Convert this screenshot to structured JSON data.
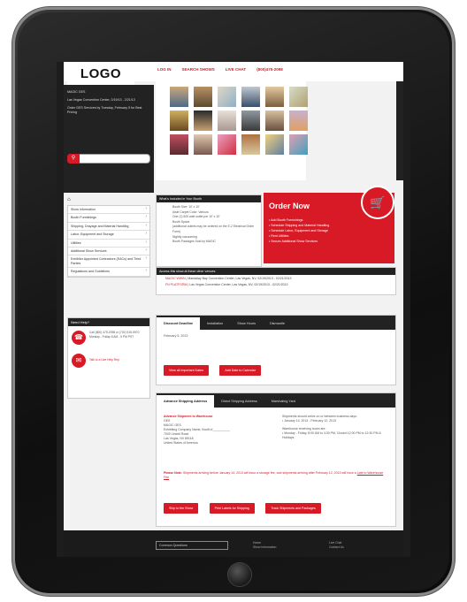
{
  "header": {
    "logo": "LOGO",
    "nav": [
      "LOG IN",
      "SEARCH SHOWS",
      "LIVE CHAT",
      "(800)475-2098"
    ]
  },
  "sidebar": {
    "show_name": "MAGIC GES",
    "location": "Las Vegas Convention Center, 2/19/13 - 2/21/13",
    "promo": "Order GES Services by Tuesday, February 5 for Best Pricing",
    "search_placeholder": "",
    "home_icon": "home-icon",
    "nav_items": [
      "Show Information",
      "Booth Furnishings",
      "Shipping, Drayage and Material Handling",
      "Labor, Equipment and Storage",
      "Utilities",
      "Additional Show Services",
      "Exhibitor Appointed Contractors (EACs) and Third Parties",
      "Regulations and Guidelines"
    ],
    "help": {
      "title": "Need Help?",
      "phone": "Call (800) 475-2098 or (702) 515-5970 Monday - Friday 8 AM - 5 PM PST",
      "chat": "Talk to a Live Help Rep"
    }
  },
  "included": {
    "title": "What's Included in Your Booth",
    "items": [
      "Booth Size: 10' x 10'",
      "Aisle Carpet Color: Various",
      "One (1) 500 watt outlet per 10' x 10'",
      "Booth Space",
      "(additional outlets may be ordered on the E-2 Electrical Order Form)",
      "Nightly vacuuming",
      "Booth Packages Sold by MAGIC"
    ]
  },
  "order_now": {
    "title": "Order Now",
    "cart_icon": "cart-icon",
    "items": [
      "Add Booth Furnishings",
      "Schedule Shipping and Material Handling",
      "Schedule Labor, Equipment and Storage",
      "Rent Utilities",
      "Secure Additional Show Services"
    ]
  },
  "other_venues": {
    "title": "Access this show at these other venues:",
    "rows": [
      {
        "link": "MAGIC WWIN",
        "text": "| Mandalay Bay Convention Center, Las Vegas, NV, 02/19/2013 - 02/21/2013"
      },
      {
        "link": "FN PLATFORM",
        "text": "| Las Vegas Convention Center, Las Vegas, NV, 02/19/2013 - 02/21/2013"
      }
    ]
  },
  "deadlines": {
    "tabs": [
      "Discount Deadline",
      "Installation",
      "Show Hours",
      "Dismantle"
    ],
    "date": "February 5, 2013",
    "buttons": [
      "View all Important Dates",
      "Add Date to Calendar"
    ]
  },
  "shipping": {
    "tabs": [
      "Advance Shipping Address",
      "Direct Shipping Address",
      "Marshaling Yard"
    ],
    "address_title": "Advance Shipment to Warehouse",
    "address_lines": [
      "GES",
      "MAGIC GES",
      "Exhibiting Company Name, Booth #__________",
      "7000 Lindell Road",
      "Las Vegas, NV 89118",
      "United States of America"
    ],
    "arrival_text": "Shipments should arrive on or between business days:",
    "arrival_range": "January 14, 2013 - February 12, 2013",
    "hours_title": "Warehouse receiving hours are:",
    "hours": "Monday - Friday, 8:00 AM to 4:30 PM, Closed 12:00 PM to 12:30 PM & Holidays",
    "note_label": "Please Note:",
    "note_text": "Shipments arriving before January 14, 2013 will incur a storage fee, and shipments arriving after February 12, 2013 will incur a",
    "note_link": "Late to Warehouse Fee",
    "buttons": [
      "Ship to the Show",
      "Print Labels for Shipping",
      "Track Shipments and Packages"
    ]
  },
  "footer": {
    "faq": "Common Questions",
    "col1": [
      "Home",
      "Show Information"
    ],
    "col2": [
      "Live Chat",
      "Contact Us"
    ]
  },
  "colors": {
    "accent": "#d71a26",
    "dark": "#222222",
    "frame": "#111111"
  }
}
